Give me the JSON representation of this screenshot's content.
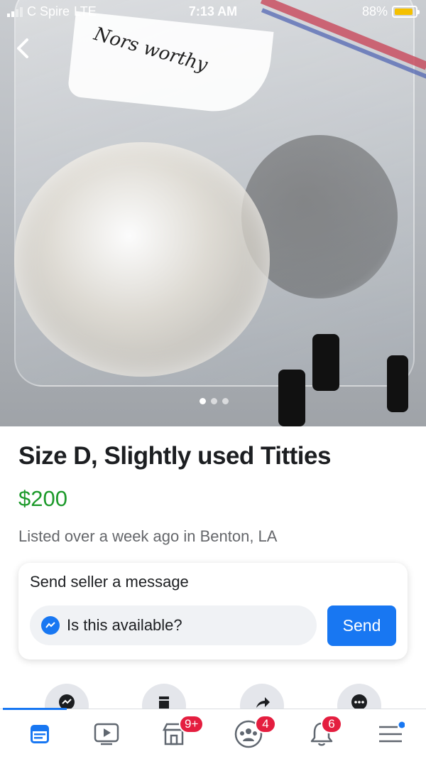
{
  "status_bar": {
    "carrier": "C Spire",
    "network": "LTE",
    "time": "7:13 AM",
    "battery_percent": "88%",
    "battery_level": 0.88,
    "battery_color": "#f4c000"
  },
  "photo": {
    "handwritten_label": "Nors worthy",
    "page_count": 3,
    "current_page": 1
  },
  "listing": {
    "title": "Size D, Slightly used Titties",
    "price": "$200",
    "listed_text": "Listed over a week ago in Benton, LA",
    "price_color": "#1d9a2b"
  },
  "message_card": {
    "heading": "Send seller a message",
    "input_value": "Is this available?",
    "send_label": "Send"
  },
  "actions": [
    {
      "icon": "messenger-icon"
    },
    {
      "icon": "save-icon"
    },
    {
      "icon": "share-icon"
    },
    {
      "icon": "more-icon"
    }
  ],
  "tabbar": {
    "accent": "#1877f2",
    "items": [
      {
        "icon": "news-feed-icon",
        "active": true,
        "badge": ""
      },
      {
        "icon": "watch-icon",
        "active": false,
        "badge": ""
      },
      {
        "icon": "marketplace-icon",
        "active": false,
        "badge": "9+"
      },
      {
        "icon": "groups-icon",
        "active": false,
        "badge": "4"
      },
      {
        "icon": "notifications-icon",
        "active": false,
        "badge": "6"
      },
      {
        "icon": "menu-icon",
        "active": false,
        "badge": ""
      }
    ]
  }
}
